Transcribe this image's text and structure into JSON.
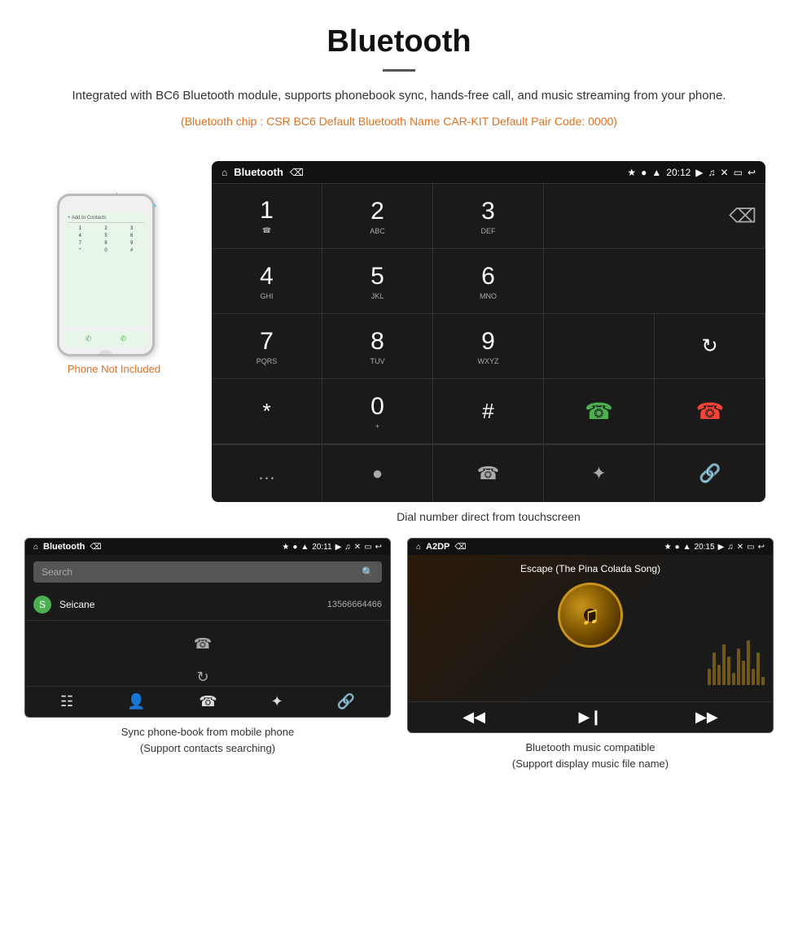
{
  "header": {
    "title": "Bluetooth",
    "description": "Integrated with BC6 Bluetooth module, supports phonebook sync, hands-free call, and music streaming from your phone.",
    "orange_info": "(Bluetooth chip : CSR BC6    Default Bluetooth Name CAR-KIT    Default Pair Code: 0000)"
  },
  "phone_area": {
    "not_included_label": "Phone Not Included",
    "not_included_orange": "Phone Not Included"
  },
  "dial_screen": {
    "status": {
      "title": "Bluetooth",
      "time": "20:12"
    },
    "keys": [
      {
        "num": "1",
        "sub": ""
      },
      {
        "num": "2",
        "sub": "ABC"
      },
      {
        "num": "3",
        "sub": "DEF"
      },
      {
        "num": "4",
        "sub": "GHI"
      },
      {
        "num": "5",
        "sub": "JKL"
      },
      {
        "num": "6",
        "sub": "MNO"
      },
      {
        "num": "7",
        "sub": "PQRS"
      },
      {
        "num": "8",
        "sub": "TUV"
      },
      {
        "num": "9",
        "sub": "WXYZ"
      },
      {
        "num": "*",
        "sub": ""
      },
      {
        "num": "0",
        "sub": "+"
      },
      {
        "num": "#",
        "sub": ""
      }
    ],
    "caption": "Dial number direct from touchscreen"
  },
  "phonebook": {
    "status": {
      "title": "Bluetooth",
      "time": "20:11"
    },
    "search_placeholder": "Search",
    "contacts": [
      {
        "initial": "S",
        "name": "Seicane",
        "number": "13566664466"
      }
    ],
    "caption_line1": "Sync phone-book from mobile phone",
    "caption_line2": "(Support contacts searching)"
  },
  "music": {
    "status": {
      "title": "A2DP",
      "time": "20:15"
    },
    "song_title": "Escape (The Pina Colada Song)",
    "caption_line1": "Bluetooth music compatible",
    "caption_line2": "(Support display music file name)"
  }
}
